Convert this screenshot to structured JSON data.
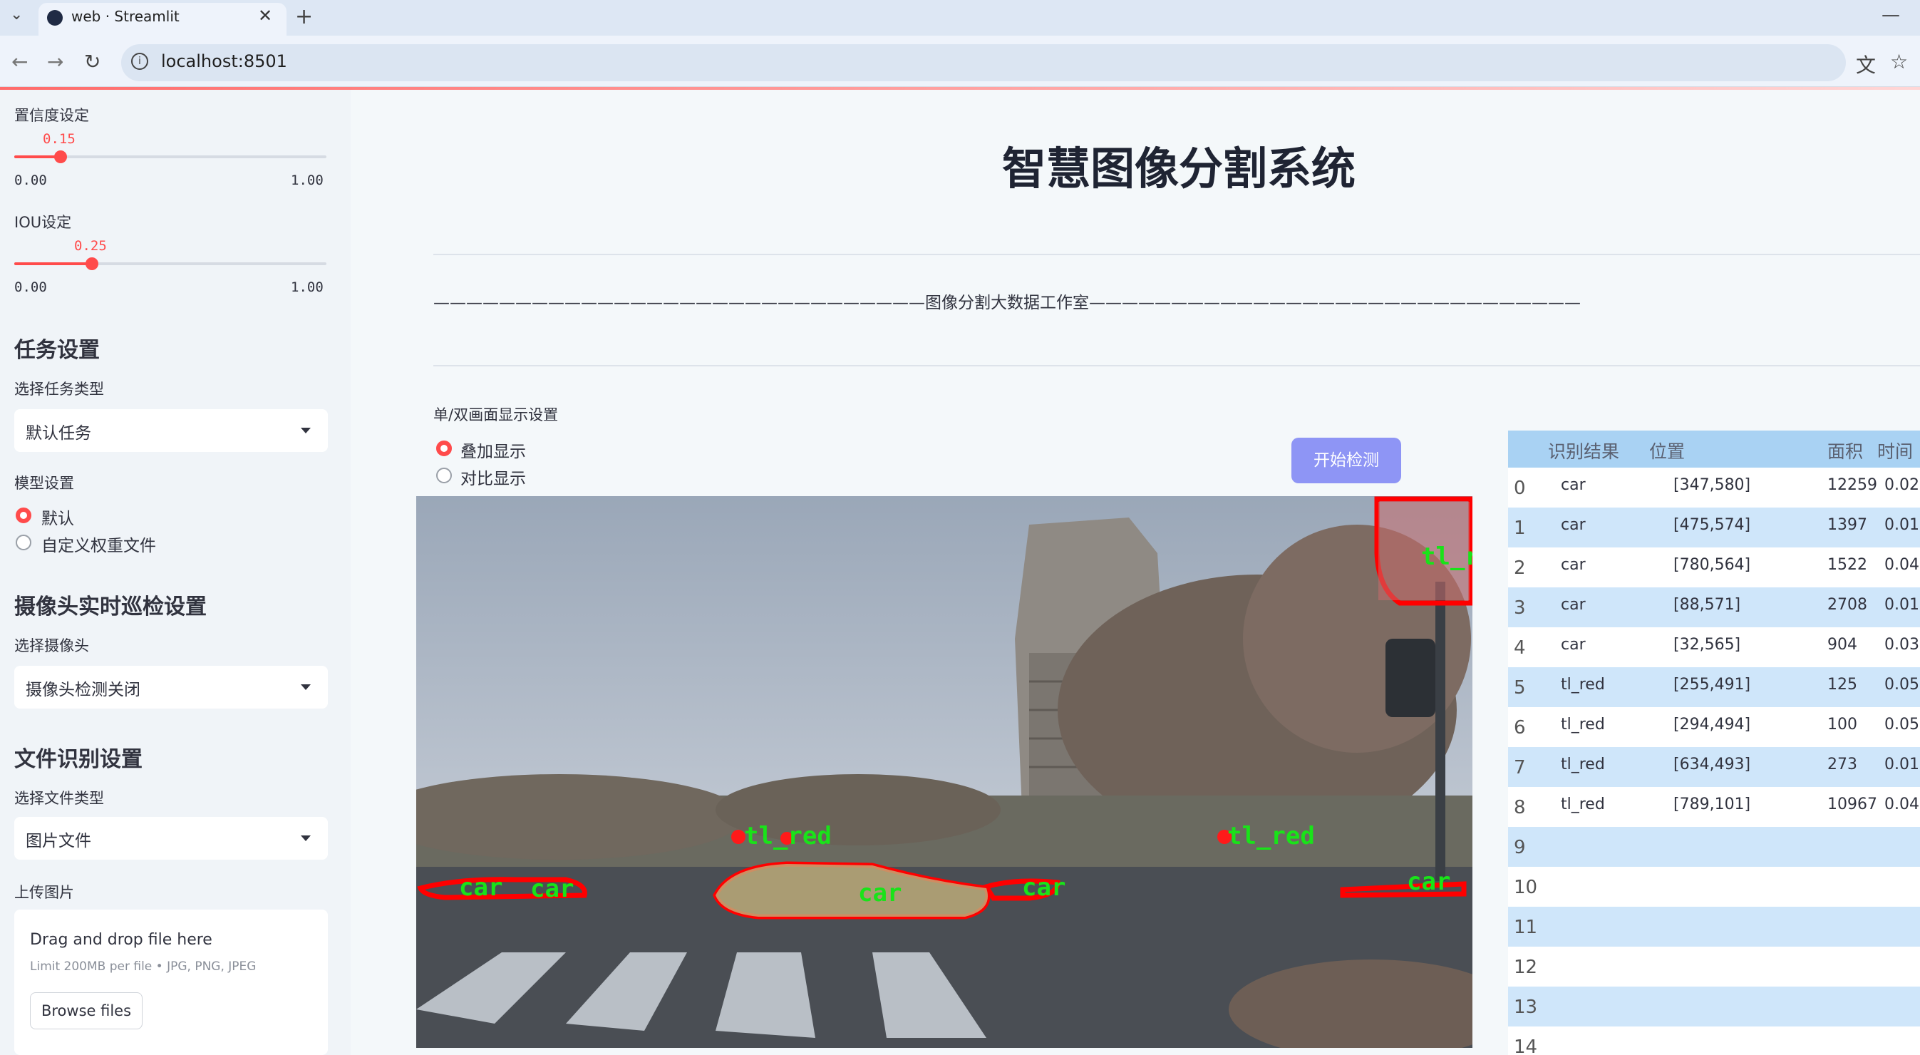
{
  "browser": {
    "tab_title": "web · Streamlit",
    "url": "localhost:8501"
  },
  "sidebar": {
    "confidence": {
      "label": "置信度设定",
      "value": "0.15",
      "min": "0.00",
      "max": "1.00",
      "fraction": 0.15
    },
    "iou": {
      "label": "IOU设定",
      "value": "0.25",
      "min": "0.00",
      "max": "1.00",
      "fraction": 0.25
    },
    "task_heading": "任务设置",
    "task_type_label": "选择任务类型",
    "task_type_value": "默认任务",
    "model_label": "模型设置",
    "model_options": [
      "默认",
      "自定义权重文件"
    ],
    "model_selected": 0,
    "camera_heading": "摄像头实时巡检设置",
    "camera_label": "选择摄像头",
    "camera_value": "摄像头检测关闭",
    "file_heading": "文件识别设置",
    "file_type_label": "选择文件类型",
    "file_type_value": "图片文件",
    "upload_label": "上传图片",
    "uploader": {
      "title": "Drag and drop file here",
      "hint": "Limit 200MB per file • JPG, PNG, JPEG",
      "button": "Browse files"
    }
  },
  "main": {
    "title": "智慧图像分割系统",
    "divider": "——————————————————————————————图像分割大数据工作室——————————————————————————————",
    "display_label": "单/双画面显示设置",
    "display_options": [
      "叠加显示",
      "对比显示"
    ],
    "display_selected": 0,
    "start_button": "开始检测",
    "overlay_labels": [
      "tl_r",
      "tl_red",
      "tl_red",
      "car",
      "car",
      "car",
      "car",
      "car"
    ]
  },
  "table": {
    "headers": [
      "识别结果",
      "位置",
      "面积",
      "时间"
    ],
    "rows": [
      {
        "idx": "0",
        "label": "car",
        "pos": "[347,580]",
        "area": "12259",
        "time": "0.02"
      },
      {
        "idx": "1",
        "label": "car",
        "pos": "[475,574]",
        "area": "1397",
        "time": "0.01"
      },
      {
        "idx": "2",
        "label": "car",
        "pos": "[780,564]",
        "area": "1522",
        "time": "0.04"
      },
      {
        "idx": "3",
        "label": "car",
        "pos": "[88,571]",
        "area": "2708",
        "time": "0.01"
      },
      {
        "idx": "4",
        "label": "car",
        "pos": "[32,565]",
        "area": "904",
        "time": "0.03"
      },
      {
        "idx": "5",
        "label": "tl_red",
        "pos": "[255,491]",
        "area": "125",
        "time": "0.05"
      },
      {
        "idx": "6",
        "label": "tl_red",
        "pos": "[294,494]",
        "area": "100",
        "time": "0.05"
      },
      {
        "idx": "7",
        "label": "tl_red",
        "pos": "[634,493]",
        "area": "273",
        "time": "0.01"
      },
      {
        "idx": "8",
        "label": "tl_red",
        "pos": "[789,101]",
        "area": "10967",
        "time": "0.04"
      },
      {
        "idx": "9",
        "label": "",
        "pos": "",
        "area": "",
        "time": ""
      },
      {
        "idx": "10",
        "label": "",
        "pos": "",
        "area": "",
        "time": ""
      },
      {
        "idx": "11",
        "label": "",
        "pos": "",
        "area": "",
        "time": ""
      },
      {
        "idx": "12",
        "label": "",
        "pos": "",
        "area": "",
        "time": ""
      },
      {
        "idx": "13",
        "label": "",
        "pos": "",
        "area": "",
        "time": ""
      },
      {
        "idx": "14",
        "label": "",
        "pos": "",
        "area": "",
        "time": ""
      }
    ]
  },
  "colors": {
    "accent": "#ff4b4b",
    "button": "#8e95f5",
    "table_header": "#a9d2f3",
    "table_stripe": "#cfe6fa"
  }
}
